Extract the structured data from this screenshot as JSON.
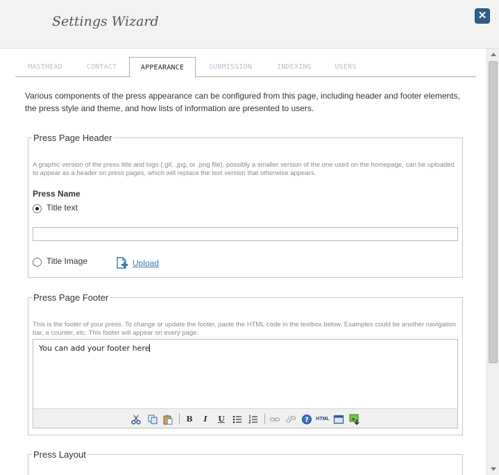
{
  "dialog": {
    "title": "Settings Wizard",
    "close_glyph": "✕"
  },
  "tabs": [
    {
      "label": "MASTHEAD",
      "active": false
    },
    {
      "label": "CONTACT",
      "active": false
    },
    {
      "label": "APPEARANCE",
      "active": true
    },
    {
      "label": "SUBMISSION",
      "active": false
    },
    {
      "label": "INDEXING",
      "active": false
    },
    {
      "label": "USERS",
      "active": false
    }
  ],
  "intro": "Various components of the press appearance can be configured from this page, including header and footer elements, the press style and theme, and how lists of information are presented to users.",
  "header_section": {
    "legend": "Press Page Header",
    "description": "A graphic version of the press title and logo (.gif, .jpg, or .png file), possibly a smaller version of the one used on the homepage, can be uploaded to appear as a header on press pages, which will replace the text version that otherwise appears.",
    "press_name_label": "Press Name",
    "option_title_text": "Title text",
    "option_title_image": "Title Image",
    "selected_option": "Title text",
    "title_text_value": "",
    "upload_label": "Upload",
    "upload_icon": "upload-file-icon"
  },
  "footer_section": {
    "legend": "Press Page Footer",
    "description": "This is the footer of your press. To change or update the footer, paste the HTML code in the textbox below. Examples could be another navigation bar, a counter, etc. This footer will appear on every page.",
    "editor_value": "You can add your footer here",
    "toolbar": {
      "bold": "B",
      "italic": "I",
      "underline": "U",
      "html": "HTML",
      "help": "?"
    }
  },
  "layout_section": {
    "legend": "Press Layout"
  },
  "colors": {
    "accent": "#2f5d86",
    "link": "#3b77a8",
    "inactive_tab": "#b5c3d0"
  }
}
